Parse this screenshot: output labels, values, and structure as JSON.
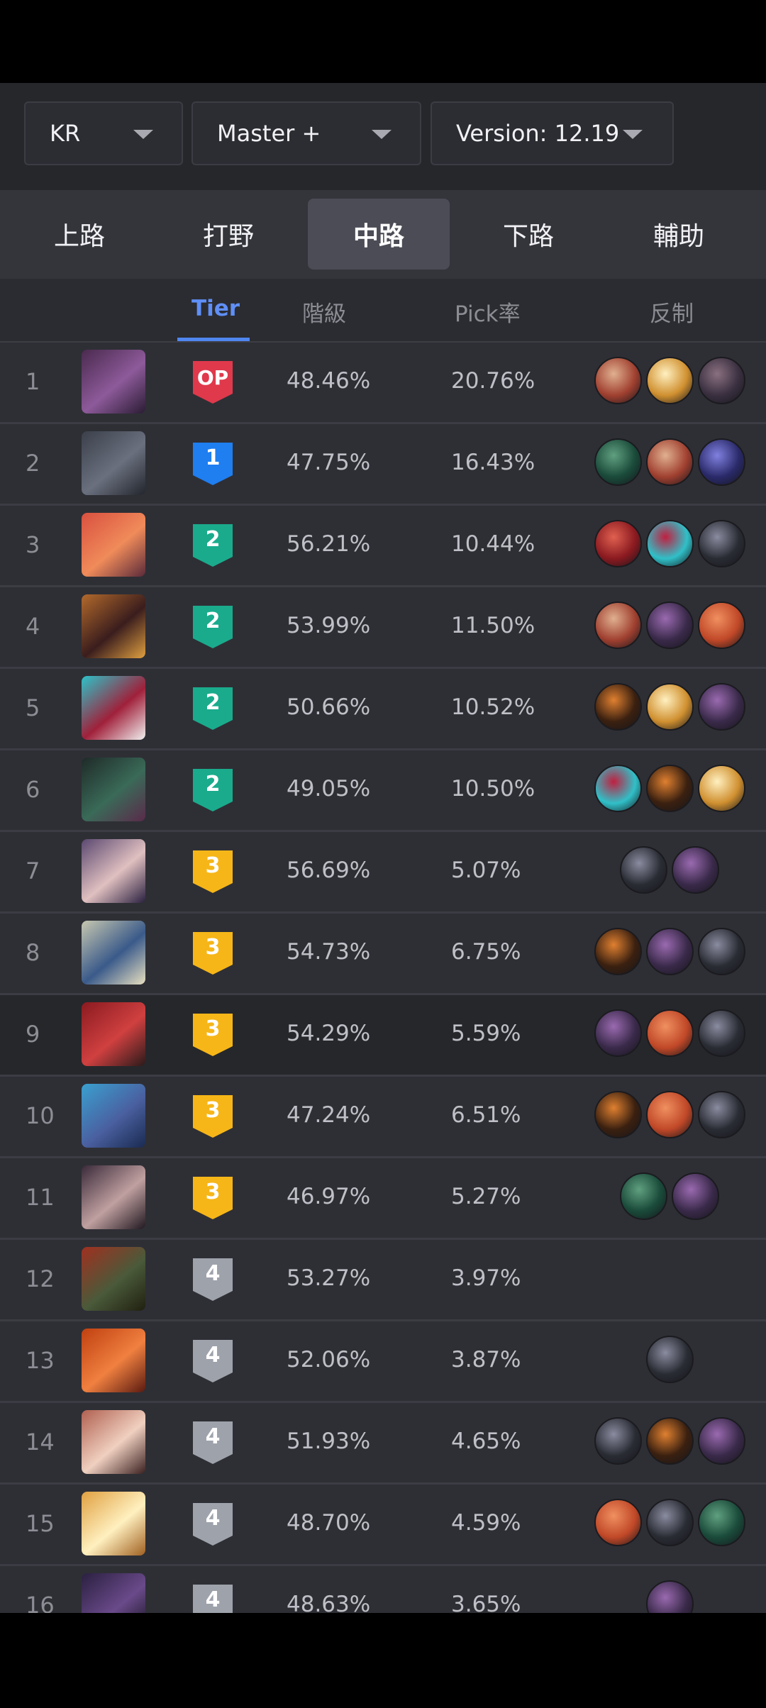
{
  "filters": {
    "region": "KR",
    "rank": "Master +",
    "version": "Version: 12.19"
  },
  "lanes": [
    {
      "label": "上路",
      "active": false
    },
    {
      "label": "打野",
      "active": false
    },
    {
      "label": "中路",
      "active": true
    },
    {
      "label": "下路",
      "active": false
    },
    {
      "label": "輔助",
      "active": false
    }
  ],
  "columns": {
    "tier": "Tier",
    "winrate": "階級",
    "pickrate": "Pick率",
    "counter": "反制"
  },
  "colors": {
    "tier_op": "#e0394c",
    "tier_1": "#1f7ef0",
    "tier_2": "#1aab8c",
    "tier_3": "#f6b618",
    "tier_4": "#9ea2ab",
    "accent": "#5f8ff7"
  },
  "rows": [
    {
      "rank": "1",
      "tier": "OP",
      "winrate": "48.46%",
      "pickrate": "20.76%",
      "counters": 3
    },
    {
      "rank": "2",
      "tier": "1",
      "winrate": "47.75%",
      "pickrate": "16.43%",
      "counters": 3
    },
    {
      "rank": "3",
      "tier": "2",
      "winrate": "56.21%",
      "pickrate": "10.44%",
      "counters": 3
    },
    {
      "rank": "4",
      "tier": "2",
      "winrate": "53.99%",
      "pickrate": "11.50%",
      "counters": 3
    },
    {
      "rank": "5",
      "tier": "2",
      "winrate": "50.66%",
      "pickrate": "10.52%",
      "counters": 3
    },
    {
      "rank": "6",
      "tier": "2",
      "winrate": "49.05%",
      "pickrate": "10.50%",
      "counters": 3
    },
    {
      "rank": "7",
      "tier": "3",
      "winrate": "56.69%",
      "pickrate": "5.07%",
      "counters": 2
    },
    {
      "rank": "8",
      "tier": "3",
      "winrate": "54.73%",
      "pickrate": "6.75%",
      "counters": 3
    },
    {
      "rank": "9",
      "tier": "3",
      "winrate": "54.29%",
      "pickrate": "5.59%",
      "counters": 3
    },
    {
      "rank": "10",
      "tier": "3",
      "winrate": "47.24%",
      "pickrate": "6.51%",
      "counters": 3
    },
    {
      "rank": "11",
      "tier": "3",
      "winrate": "46.97%",
      "pickrate": "5.27%",
      "counters": 2
    },
    {
      "rank": "12",
      "tier": "4",
      "winrate": "53.27%",
      "pickrate": "3.97%",
      "counters": 0
    },
    {
      "rank": "13",
      "tier": "4",
      "winrate": "52.06%",
      "pickrate": "3.87%",
      "counters": 1
    },
    {
      "rank": "14",
      "tier": "4",
      "winrate": "51.93%",
      "pickrate": "4.65%",
      "counters": 3
    },
    {
      "rank": "15",
      "tier": "4",
      "winrate": "48.70%",
      "pickrate": "4.59%",
      "counters": 3
    },
    {
      "rank": "16",
      "tier": "4",
      "winrate": "48.63%",
      "pickrate": "3.65%",
      "counters": 1
    }
  ]
}
